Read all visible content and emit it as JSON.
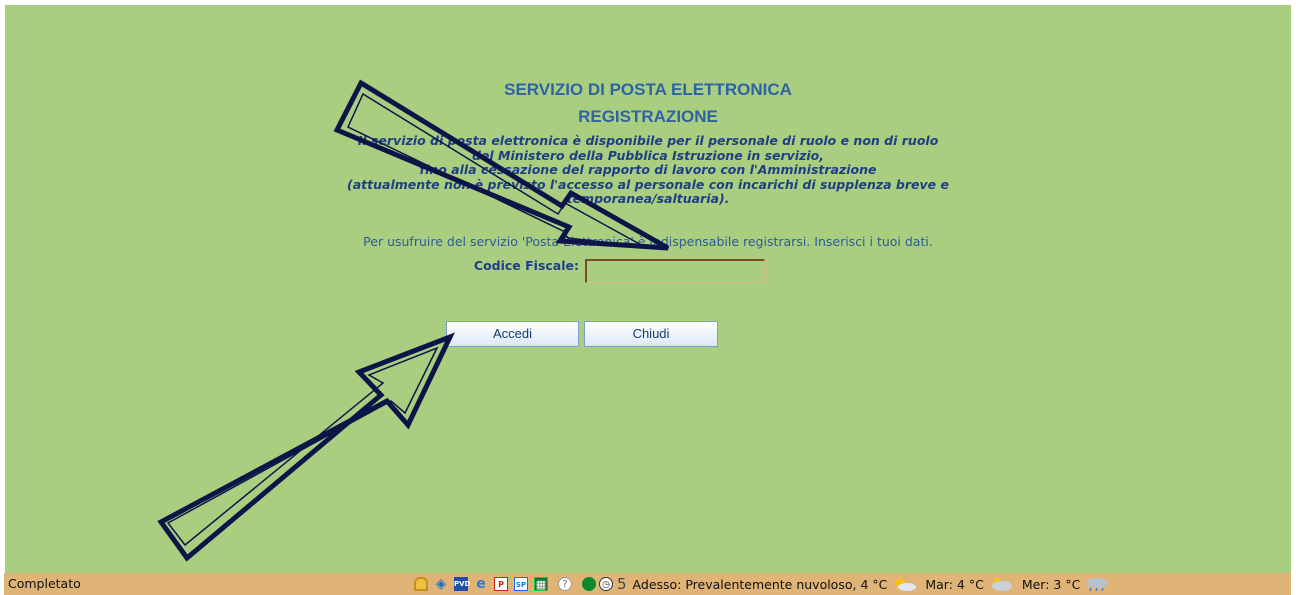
{
  "header": {
    "title_line1": "SERVIZIO DI POSTA ELETTRONICA",
    "title_line2": "REGISTRAZIONE"
  },
  "notice": {
    "line1": "Il servizio di posta elettronica è disponibile per il personale di ruolo e non di ruolo",
    "line2": "del Ministero della Pubblica Istruzione in servizio,",
    "line3": "fino alla cessazione del rapporto di lavoro con l'Amministrazione",
    "line4": "(attualmente non è previsto l'accesso al personale con incarichi di supplenza breve e",
    "line5": "temporanea/saltuaria)."
  },
  "form": {
    "instructions": "Per usufruire del servizio 'Posta Elettronica' è indispensabile registrarsi. Inserisci i tuoi dati.",
    "codice_fiscale_label": "Codice Fiscale:",
    "codice_fiscale_value": ""
  },
  "buttons": {
    "accedi": "Accedi",
    "chiudi": "Chiudi"
  },
  "statusbar": {
    "status": "Completato",
    "icons": [
      "lock-icon",
      "eye-icon",
      "pvd-icon",
      "ie-icon",
      "pdf-icon",
      "sp-icon",
      "calculator-icon",
      "pin-icon",
      "green-dot-icon",
      "clock-icon"
    ],
    "counter": "5",
    "weather_now": "Adesso: Prevalentemente nuvoloso, 4 °C",
    "weather_tue": "Mar: 4 °C",
    "weather_wed": "Mer: 3 °C"
  },
  "colors": {
    "page_background": "#a9ce80",
    "title": "#2e63a4",
    "statusbar": "#e0b476",
    "arrow": "#0d1548"
  }
}
